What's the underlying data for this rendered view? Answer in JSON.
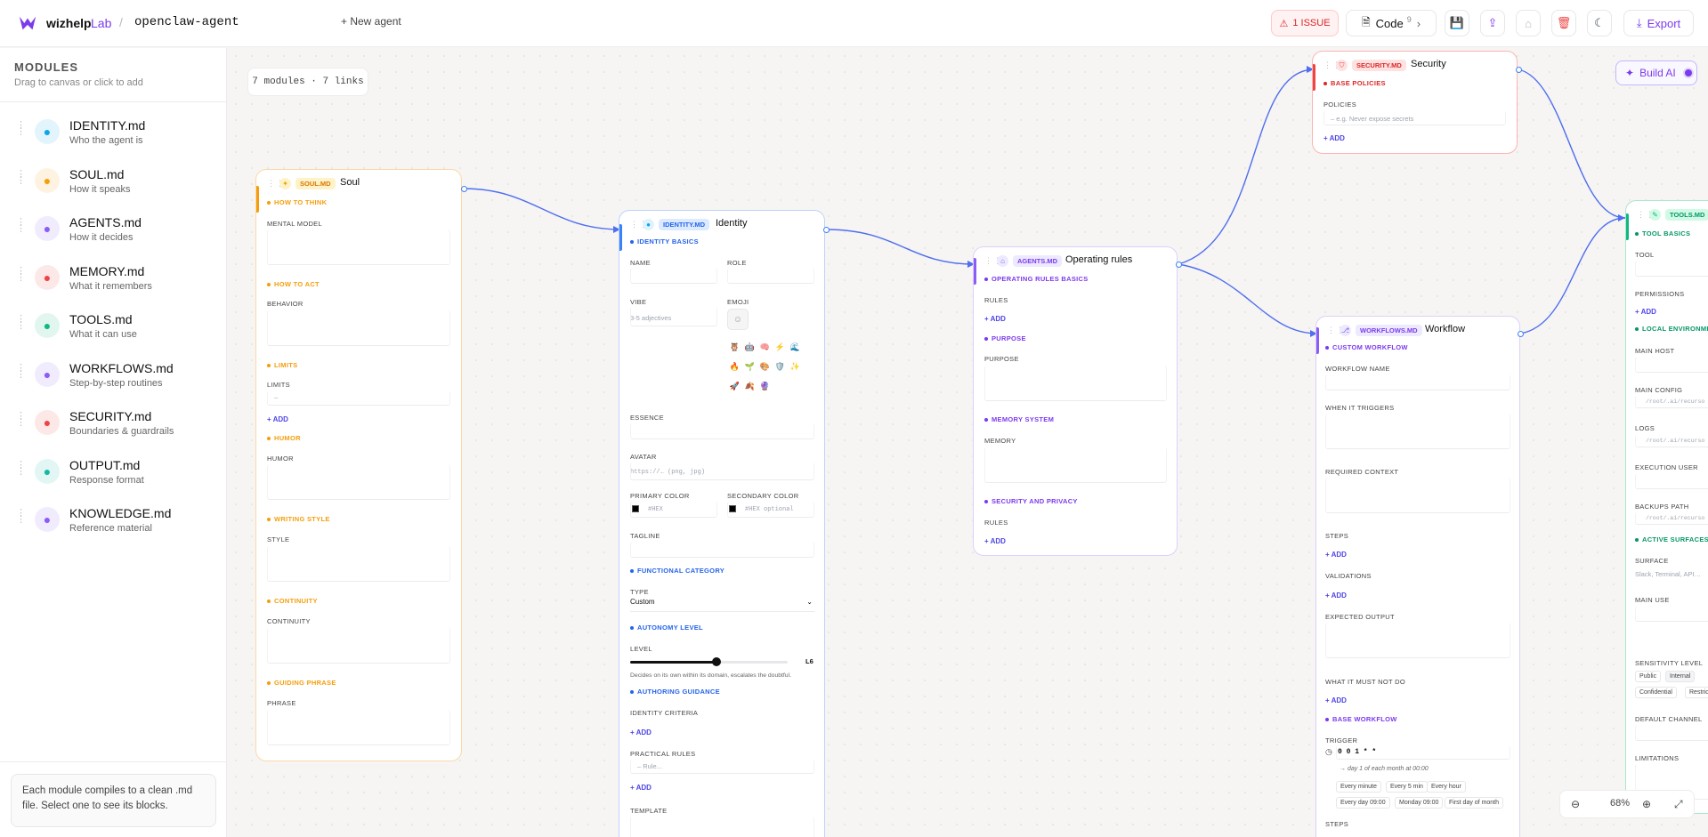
{
  "topbar": {
    "brand": "wizhelp",
    "brand_suffix": "Lab",
    "separator": "/",
    "agent_name": "openclaw-agent",
    "new_agent": "+ New agent",
    "issue_label": "1 ISSUE",
    "code_label": "Code",
    "code_count": "9",
    "export_label": "Export"
  },
  "sidebar": {
    "title": "MODULES",
    "subtitle": "Drag to canvas or click to add",
    "items": [
      {
        "name": "IDENTITY.md",
        "desc": "Who the agent is",
        "icon": "user-icon",
        "color": "#0ea5e9"
      },
      {
        "name": "SOUL.md",
        "desc": "How it speaks",
        "icon": "sparkle-icon",
        "color": "#f59e0b"
      },
      {
        "name": "AGENTS.md",
        "desc": "How it decides",
        "icon": "robot-icon",
        "color": "#8b5cf6"
      },
      {
        "name": "MEMORY.md",
        "desc": "What it remembers",
        "icon": "database-icon",
        "color": "#ef4444"
      },
      {
        "name": "TOOLS.md",
        "desc": "What it can use",
        "icon": "wrench-icon",
        "color": "#10b981"
      },
      {
        "name": "WORKFLOWS.md",
        "desc": "Step-by-step routines",
        "icon": "workflow-icon",
        "color": "#8b5cf6"
      },
      {
        "name": "SECURITY.md",
        "desc": "Boundaries & guardrails",
        "icon": "shield-icon",
        "color": "#ef4444"
      },
      {
        "name": "OUTPUT.md",
        "desc": "Response format",
        "icon": "file-output-icon",
        "color": "#14b8a6"
      },
      {
        "name": "KNOWLEDGE.md",
        "desc": "Reference material",
        "icon": "book-icon",
        "color": "#8b5cf6"
      }
    ],
    "note": "Each module compiles to a clean .md file. Select one to see its blocks."
  },
  "canvas": {
    "counter": "7 modules · 7 links",
    "build_ai": "Build AI",
    "zoom": "68%"
  },
  "soul": {
    "badge": "SOUL.MD",
    "title": "Soul",
    "s1": "HOW TO THINK",
    "f1": "MENTAL MODEL",
    "s2": "HOW TO ACT",
    "f2": "BEHAVIOR",
    "s3": "LIMITS",
    "f3": "LIMITS",
    "f3_ph": "–",
    "add": "+ ADD",
    "s4": "HUMOR",
    "f4": "HUMOR",
    "s5": "WRITING STYLE",
    "f5": "STYLE",
    "s6": "CONTINUITY",
    "f6": "CONTINUITY",
    "s7": "GUIDING PHRASE",
    "f7": "PHRASE"
  },
  "identity": {
    "badge": "IDENTITY.MD",
    "title": "Identity",
    "s1": "IDENTITY BASICS",
    "name": "NAME",
    "role": "ROLE",
    "vibe": "VIBE",
    "vibe_ph": "3-5 adjectives",
    "emoji": "EMOJI",
    "emojis": [
      "🦉",
      "🤖",
      "🧠",
      "⚡",
      "🌊",
      "🔥",
      "🌱",
      "🎨",
      "🛡️",
      "✨",
      "🚀",
      "🍂",
      "🔮"
    ],
    "essence": "ESSENCE",
    "avatar": "AVATAR",
    "avatar_ph": "https://… (png, jpg)",
    "primary": "PRIMARY COLOR",
    "primary_ph": "#HEX",
    "secondary": "SECONDARY COLOR",
    "secondary_ph": "#HEX optional",
    "tagline": "TAGLINE",
    "s2": "FUNCTIONAL CATEGORY",
    "type": "TYPE",
    "type_value": "Custom",
    "s3": "AUTONOMY LEVEL",
    "level": "LEVEL",
    "level_value": "L6",
    "level_fraction": 0.55,
    "level_desc": "Decides on its own within its domain, escalates the doubtful.",
    "s4": "AUTHORING GUIDANCE",
    "criteria": "IDENTITY CRITERIA",
    "add": "+ ADD",
    "rules": "PRACTICAL RULES",
    "rules_ph": "– Rule...",
    "template": "TEMPLATE"
  },
  "agents": {
    "badge": "AGENTS.MD",
    "title": "Operating rules",
    "s1": "OPERATING RULES BASICS",
    "rules": "RULES",
    "add": "+ ADD",
    "s2": "PURPOSE",
    "purpose": "PURPOSE",
    "s3": "MEMORY SYSTEM",
    "memory": "MEMORY",
    "s4": "SECURITY AND PRIVACY",
    "rules2": "RULES"
  },
  "security": {
    "badge": "SECURITY.MD",
    "title": "Security",
    "s1": "BASE POLICIES",
    "policies": "POLICIES",
    "policies_ph": "– e.g. Never expose secrets",
    "add": "+ ADD"
  },
  "workflow": {
    "badge": "WORKFLOWS.MD",
    "title": "Workflow",
    "s1": "CUSTOM WORKFLOW",
    "name": "WORKFLOW NAME",
    "triggers": "WHEN IT TRIGGERS",
    "context": "REQUIRED CONTEXT",
    "steps": "STEPS",
    "add": "+ ADD",
    "validations": "VALIDATIONS",
    "expected": "EXPECTED OUTPUT",
    "must_not": "WHAT IT MUST NOT DO",
    "s2": "BASE WORKFLOW",
    "trigger": "TRIGGER",
    "cron": "0 0 1 * *",
    "cron_desc": "→ day 1 of each month at 00:00",
    "chips": [
      "Every minute",
      "Every 5 min",
      "Every hour",
      "Every day 09:00",
      "Monday 09:00",
      "First day of month"
    ],
    "steps2": "STEPS"
  },
  "tools": {
    "badge": "TOOLS.MD",
    "s1": "TOOL BASICS",
    "tool": "TOOL",
    "permissions": "PERMISSIONS",
    "add": "+ ADD",
    "s2": "LOCAL ENVIRONMENT",
    "main_host": "MAIN HOST",
    "main_config": "MAIN CONFIG",
    "config_ph": "/root/.ai/recurso",
    "logs": "LOGS",
    "logs_ph": "/root/.ai/recurso",
    "exec_user": "EXECUTION USER",
    "backups": "BACKUPS PATH",
    "backups_ph": "/root/.ai/recurso",
    "s3": "ACTIVE SURFACES",
    "surface": "SURFACE",
    "surface_ph": "Slack, Terminal, API…",
    "main_use": "MAIN USE",
    "sensitivity": "SENSITIVITY LEVEL",
    "sens_opts": [
      "Public",
      "Internal",
      "Confidential",
      "Restrict"
    ],
    "default_channel": "DEFAULT CHANNEL",
    "limitations": "LIMITATIONS"
  },
  "colors": {
    "accent": "#7c3aed",
    "link": "#4f6ef0",
    "soul": "#f59e0b",
    "identity": "#3b82f6",
    "agents": "#8b5cf6",
    "security": "#ef4444",
    "workflow": "#8b5cf6",
    "tools": "#10b981"
  }
}
